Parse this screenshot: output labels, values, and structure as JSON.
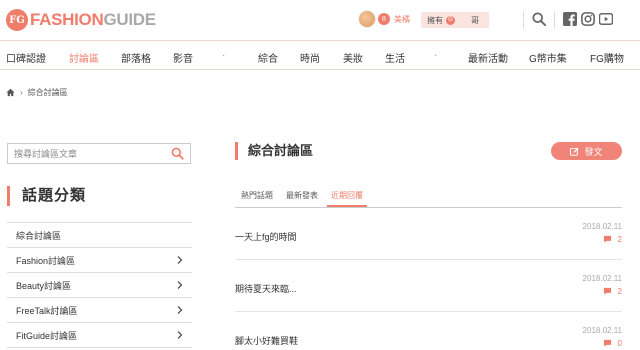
{
  "header": {
    "logo_badge": "FG",
    "logo_fashion": "FASHION",
    "logo_guide": "GUIDE",
    "user": {
      "badge": "8",
      "name": "美橘"
    },
    "coins": {
      "label": "擁有",
      "coin_symbol": "G",
      "redeem": "哥"
    }
  },
  "nav": {
    "items": [
      {
        "label": "口碑認證"
      },
      {
        "label": "討論區",
        "active": true
      },
      {
        "label": "部落格"
      },
      {
        "label": "影音"
      },
      {
        "label": "·"
      },
      {
        "label": "綜合"
      },
      {
        "label": "時尚"
      },
      {
        "label": "美妝"
      },
      {
        "label": "生活"
      },
      {
        "label": "·"
      },
      {
        "label": "最新活動"
      },
      {
        "label": "G幣市集"
      },
      {
        "label": "FG購物"
      }
    ]
  },
  "breadcrumb": {
    "current": "綜合討論區"
  },
  "search": {
    "placeholder": "搜尋討論區文章"
  },
  "sidebar": {
    "heading": "話題分類",
    "items": [
      {
        "label": "綜合討論區",
        "has_chevron": false
      },
      {
        "label": "Fashion討論區",
        "has_chevron": true
      },
      {
        "label": "Beauty討論區",
        "has_chevron": true
      },
      {
        "label": "FreeTalk討論區",
        "has_chevron": true
      },
      {
        "label": "FitGuide討論區",
        "has_chevron": true
      }
    ]
  },
  "main": {
    "heading": "綜合討論區",
    "post_button": "發文",
    "tabs": [
      {
        "label": "熱門話題"
      },
      {
        "label": "最新發表"
      },
      {
        "label": "近期回覆",
        "active": true
      }
    ],
    "topics": [
      {
        "title": "一天上fg的時間",
        "date": "2018.02.11",
        "comments": "2"
      },
      {
        "title": "期待夏天來臨...",
        "date": "2018.02.11",
        "comments": "2"
      },
      {
        "title": "腳太小好難買鞋",
        "date": "2018.02.11",
        "comments": "0"
      }
    ]
  },
  "colors": {
    "accent": "#f07c6a",
    "accent_light": "#fbe4df",
    "text": "#333333",
    "muted": "#aaaaaa"
  }
}
